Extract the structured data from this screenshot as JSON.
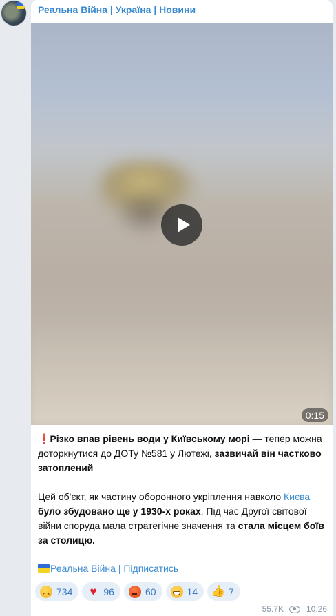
{
  "channel": {
    "name": "Реальна Війна | Україна | Новини"
  },
  "video": {
    "duration": "0:15"
  },
  "post": {
    "p1_excl": "❗",
    "p1_a": "Різко впав рівень води у Київському морі",
    "p1_b": " — тепер можна доторкнутися до ДОТу №581 у Лютежі, ",
    "p1_c": "зазвичай він частково затоплений",
    "p2_a": "Цей об'єкт, як частину оборонного укріплення навколо ",
    "p2_link": "Києва",
    "p2_b": "було збудовано ще у 1930-х роках",
    "p2_c": ". Під час Другої світової війни споруда мала стратегічне значення та ",
    "p2_d": "стала місцем боїв за столицю."
  },
  "subscribe": {
    "label": "Реальна Війна | Підписатись"
  },
  "reactions": [
    {
      "icon": "crying-face",
      "count": "734"
    },
    {
      "icon": "red-heart",
      "count": "96"
    },
    {
      "icon": "angry-face",
      "count": "60"
    },
    {
      "icon": "grinning-face",
      "count": "14"
    },
    {
      "icon": "thumbs-up",
      "count": "7"
    }
  ],
  "meta": {
    "views": "55.7K",
    "time": "10:26"
  },
  "colors": {
    "accent": "#3a8ad0",
    "flag_blue": "#2f6bd6",
    "flag_yellow": "#f5d324"
  }
}
